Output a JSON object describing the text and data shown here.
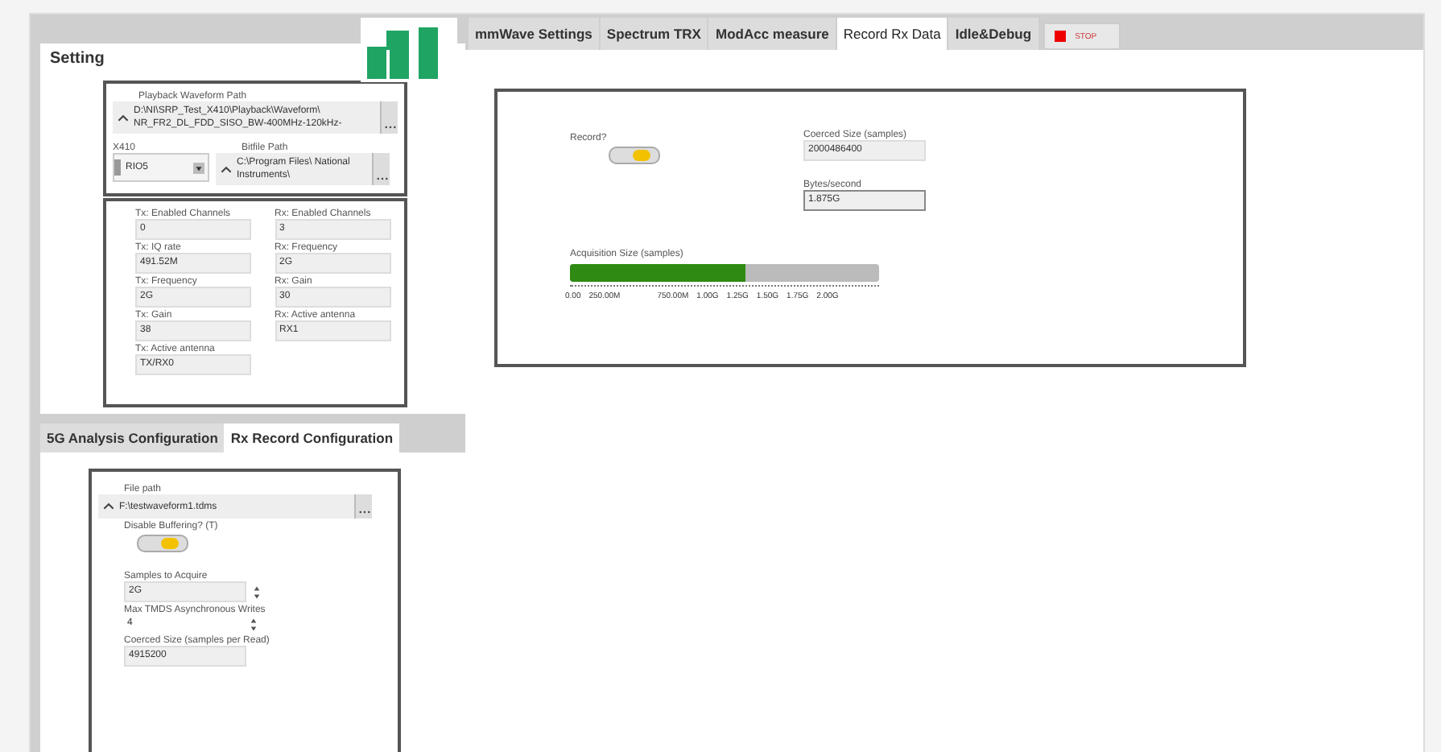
{
  "tabs": [
    {
      "label": "mmWave Settings",
      "selected": false
    },
    {
      "label": "Spectrum TRX",
      "selected": false
    },
    {
      "label": "ModAcc measure",
      "selected": false
    },
    {
      "label": "Record Rx Data",
      "selected": true
    },
    {
      "label": "Idle&Debug",
      "selected": false
    }
  ],
  "stop_button": {
    "label": "STOP"
  },
  "setting": {
    "title": "Setting",
    "waveform_path": {
      "label": "Playback Waveform Path",
      "value": "D:\\NI\\SRP_Test_X410\\Playback\\Waveform\\ NR_FR2_DL_FDD_SISO_BW-400MHz-120kHz-"
    },
    "device": {
      "label": "X410",
      "value": "RIO5"
    },
    "bitfile_path": {
      "label": "Bitfile Path",
      "value": "C:\\Program Files\\ National Instruments\\"
    },
    "params": [
      {
        "label": "Tx: Enabled Channels",
        "value": "0"
      },
      {
        "label": "Rx: Enabled Channels",
        "value": "3"
      },
      {
        "label": "Tx: IQ rate",
        "value": "491.52M"
      },
      {
        "label": "Rx: Frequency",
        "value": "2G"
      },
      {
        "label": "Tx: Frequency",
        "value": "2G"
      },
      {
        "label": "Rx: Gain",
        "value": "30"
      },
      {
        "label": "Tx: Gain",
        "value": "38"
      },
      {
        "label": "Rx: Active antenna",
        "value": "RX1"
      },
      {
        "label": "Tx: Active antenna",
        "value": "TX/RX0"
      }
    ]
  },
  "config_tabs": [
    {
      "label": "5G Analysis Configuration",
      "selected": false
    },
    {
      "label": "Rx Record Configuration",
      "selected": true
    }
  ],
  "rx_config": {
    "file_path": {
      "label": "File path",
      "value": "F:\\testwaveform1.tdms"
    },
    "disable_buffering": {
      "label": "Disable Buffering? (T)",
      "on": true
    },
    "samples_to_acquire": {
      "label": "Samples to Acquire",
      "value": "2G"
    },
    "max_writes": {
      "label": "Max TMDS Asynchronous Writes",
      "value": "4"
    },
    "coerced_per_read": {
      "label": "Coerced Size (samples per Read)",
      "value": "4915200"
    }
  },
  "record": {
    "label": "Record?",
    "on": true,
    "coerced_size": {
      "label": "Coerced Size (samples)",
      "value": "2000486400"
    },
    "bytes_per_second": {
      "label": "Bytes/second",
      "value": "1.875G"
    },
    "acquisition": {
      "label": "Acquisition Size (samples)",
      "level": 0.57,
      "ticks": [
        "0.00",
        "250.00M",
        "750.00M",
        "1.00G",
        "1.25G",
        "1.50G",
        "1.75G",
        "2.00G"
      ]
    }
  }
}
